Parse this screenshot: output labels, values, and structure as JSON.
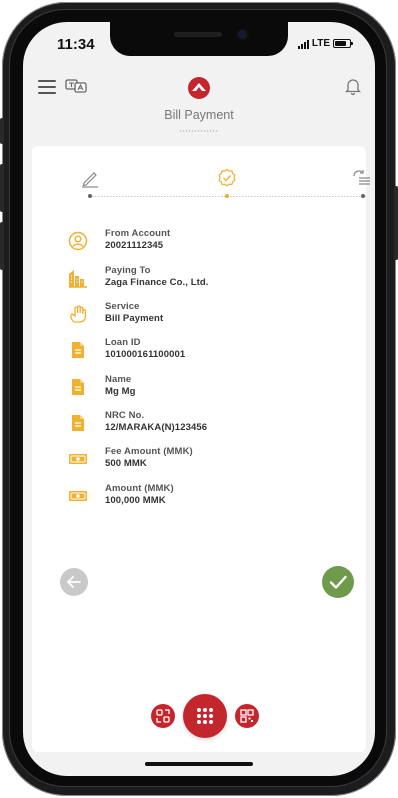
{
  "status_bar": {
    "time": "11:34",
    "network": "LTE"
  },
  "header": {
    "title": "Bill Payment"
  },
  "stepper": {
    "steps": [
      {
        "icon": "pencil-icon",
        "state": "done"
      },
      {
        "icon": "check-badge-icon",
        "state": "active"
      },
      {
        "icon": "send-list-icon",
        "state": "pending"
      }
    ]
  },
  "details": [
    {
      "icon": "user-circle-icon",
      "label": "From Account",
      "value": "20021112345"
    },
    {
      "icon": "building-icon",
      "label": "Paying To",
      "value": "Zaga Finance Co., Ltd."
    },
    {
      "icon": "hand-icon",
      "label": "Service",
      "value": "Bill Payment"
    },
    {
      "icon": "document-icon",
      "label": "Loan ID",
      "value": "101000161100001"
    },
    {
      "icon": "document-icon",
      "label": "Name",
      "value": "Mg Mg"
    },
    {
      "icon": "document-icon",
      "label": "NRC No.",
      "value": "12/MARAKA(N)123456"
    },
    {
      "icon": "banknote-icon",
      "label": "Fee Amount (MMK)",
      "value": "500 MMK"
    },
    {
      "icon": "banknote-icon",
      "label": "Amount (MMK)",
      "value": "100,000 MMK"
    }
  ],
  "colors": {
    "brand_red": "#c4262e",
    "icon_gold": "#f0b030",
    "confirm_green": "#6f9a4b",
    "back_grey": "#c9c9c9"
  }
}
